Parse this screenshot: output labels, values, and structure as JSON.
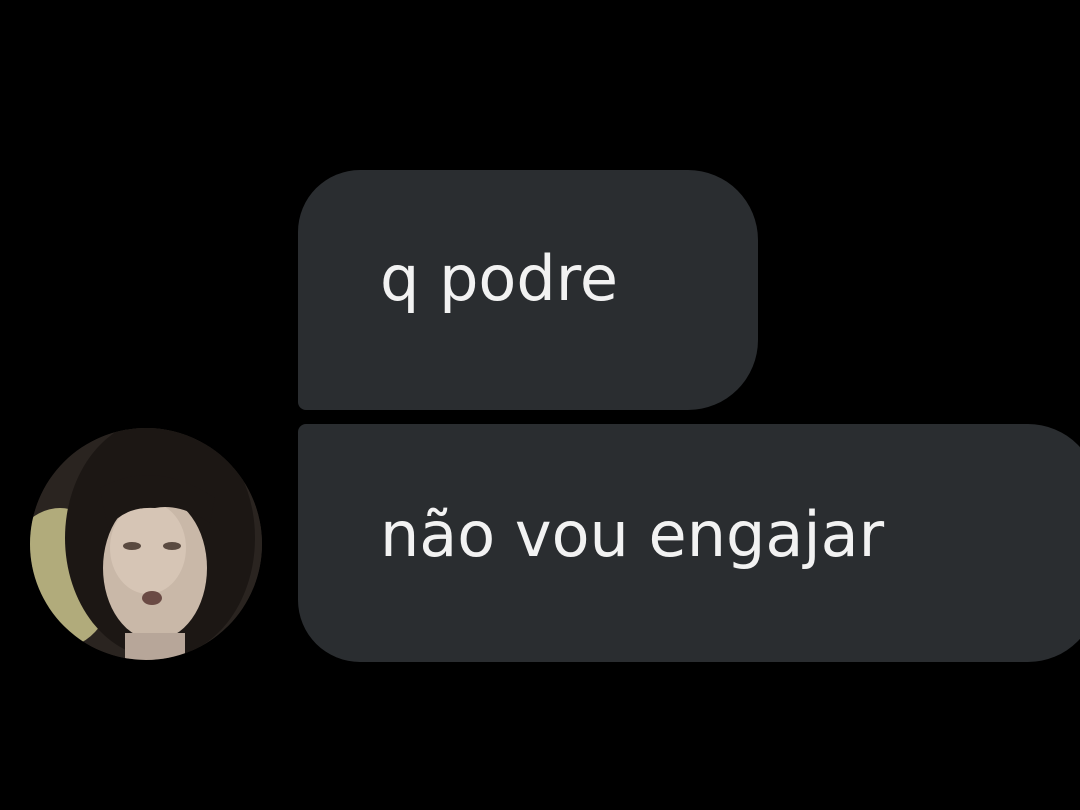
{
  "conversation": {
    "messages": [
      {
        "text": "q podre"
      },
      {
        "text": "não vou engajar"
      }
    ],
    "sender": {
      "avatar_icon": "user-avatar-photo"
    }
  },
  "colors": {
    "background": "#000000",
    "bubble": "#2a2d30",
    "bubble_text": "#f2f2f2"
  }
}
